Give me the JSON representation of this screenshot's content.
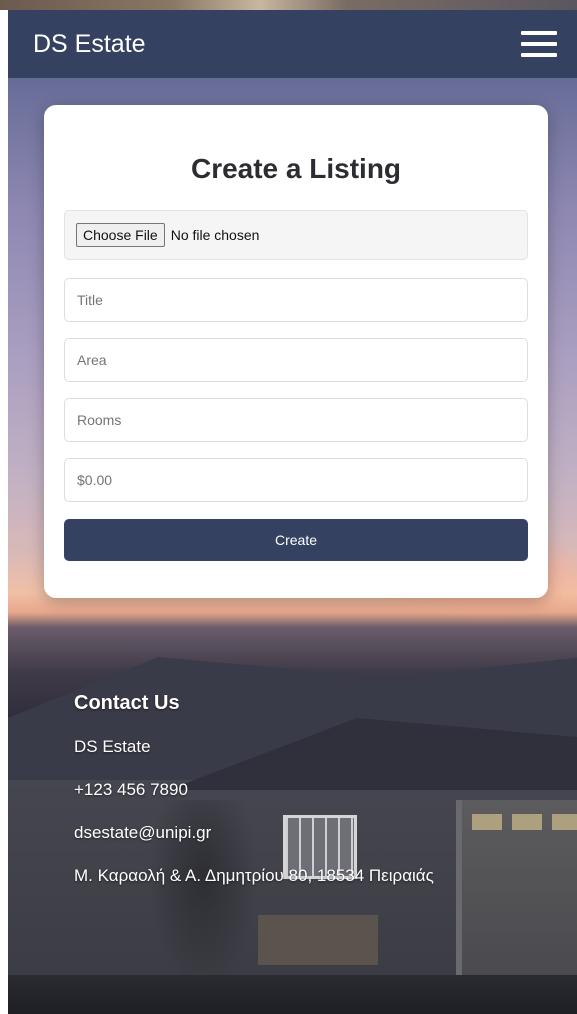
{
  "navbar": {
    "brand": "DS Estate",
    "menu_icon": "hamburger-menu-icon",
    "color": "#344161"
  },
  "form": {
    "title": "Create a Listing",
    "file_button_label": "Choose File",
    "file_status": "No file chosen",
    "title_placeholder": "Title",
    "area_placeholder": "Area",
    "rooms_placeholder": "Rooms",
    "price_placeholder": "$0.00",
    "submit_label": "Create"
  },
  "footer": {
    "heading": "Contact Us",
    "company": "DS Estate",
    "phone": "+123 456 7890",
    "email": "dsestate@unipi.gr",
    "address": "Μ. Καραολή & Α. Δημητρίου 80, 18534 Πειραιάς"
  },
  "colors": {
    "primary": "#344161",
    "card": "#ffffff"
  }
}
